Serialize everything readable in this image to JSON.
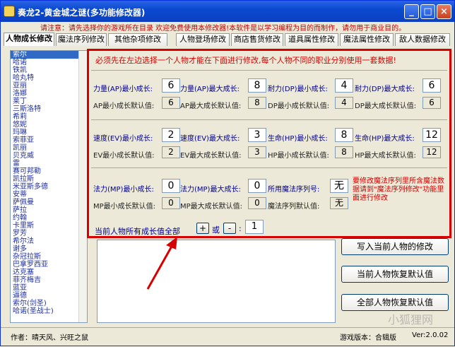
{
  "window": {
    "title": "奏龙2-黄金城之谜(多功能修改器)",
    "header_notice": "请注意：请先选择你的游戏所在目录  欢迎免费使用本修改器!本软件是以学习编程为目的而制作，请勿用于商业目的。"
  },
  "tabs": [
    "人物成长修改",
    "魔法序列修改",
    "其他杂项修改",
    "人物登场修改",
    "商店售货修改",
    "道具属性修改",
    "魔法属性修改",
    "敌人数据修改"
  ],
  "characters": [
    "索尔",
    "哈诺",
    "铁凯",
    "哈丸特",
    "亚丽",
    "洛娜",
    "莱丁",
    "三斯洛特",
    "希莉",
    "悠妮",
    "玛琳",
    "索菲亚",
    "凯丽",
    "贝克威",
    "雷",
    "赛可邦勒",
    "凯拉斯",
    "米亚斯多德",
    "安蒂",
    "萨佩曼",
    "萨拉",
    "约翰",
    "卡里斯",
    "罗芳",
    "希尔法",
    "谢多",
    "杂冠拉斯",
    "巴拿罗西亚",
    "达克塞",
    "菲齐梅吉",
    "蓝亚",
    "逼德",
    "索尔(剑圣)",
    "哈诺(圣战士)"
  ],
  "panel": {
    "warning": "必须先在左边选择一个人物才能在下面进行修改,每个人物不同的职业分别使用一套数据!",
    "row1": {
      "labels": [
        "力量(AP)最小成长:",
        "力量(AP)最大成长:",
        "耐力(DP)最小成长:",
        "耐力(DP)最大成长:"
      ],
      "values": [
        "6",
        "8",
        "4",
        "6"
      ],
      "default_labels": [
        "AP最小成长默认值:",
        "AP最大成长默认值:",
        "DP最小成长默认值:",
        "DP最大成长默认值:"
      ],
      "defaults": [
        "6",
        "8",
        "4",
        "6"
      ]
    },
    "row2": {
      "labels": [
        "速度(EV)最小成长:",
        "速度(EV)最大成长:",
        "生命(HP)最小成长:",
        "生命(HP)最大成长:"
      ],
      "values": [
        "2",
        "3",
        "8",
        "12"
      ],
      "default_labels": [
        "EV最小成长默认值:",
        "EV最大成长默认值:",
        "HP最小成长默认值:",
        "HP最大成长默认值:"
      ],
      "defaults": [
        "2",
        "3",
        "8",
        "12"
      ]
    },
    "row3": {
      "labels": [
        "法力(MP)最小成长:",
        "法力(MP)最大成长:",
        "所用魔法序列号:"
      ],
      "values": [
        "0",
        "0",
        "无"
      ],
      "default_labels": [
        "MP最小成长默认值:",
        "MP最大成长默认值:",
        "魔法序列默认值:"
      ],
      "defaults": [
        "0",
        "0",
        "无"
      ],
      "note": "要修改魔法序列里所含魔法数据请到\"魔法序列修改\"功能里面进行修改"
    },
    "all_growth": {
      "label": "当前人物所有成长值全部",
      "plus": "+",
      "or": "或",
      "minus": "-",
      "colon": ":",
      "value": "1"
    }
  },
  "buttons": {
    "write": "写入当前人物的修改",
    "restore_current": "当前人物恢复默认值",
    "restore_all": "全部人物恢复默认值"
  },
  "status": {
    "author": "作者：晴天风、兴旺之鼠",
    "game_version": "游戏版本：合辑版",
    "version": "Ver:2.0.02"
  },
  "watermark": "小狐狸网",
  "colors": {
    "title_blue": "#0a4ad0",
    "highlight_red": "#d60000",
    "selection_blue": "#316ac5"
  }
}
